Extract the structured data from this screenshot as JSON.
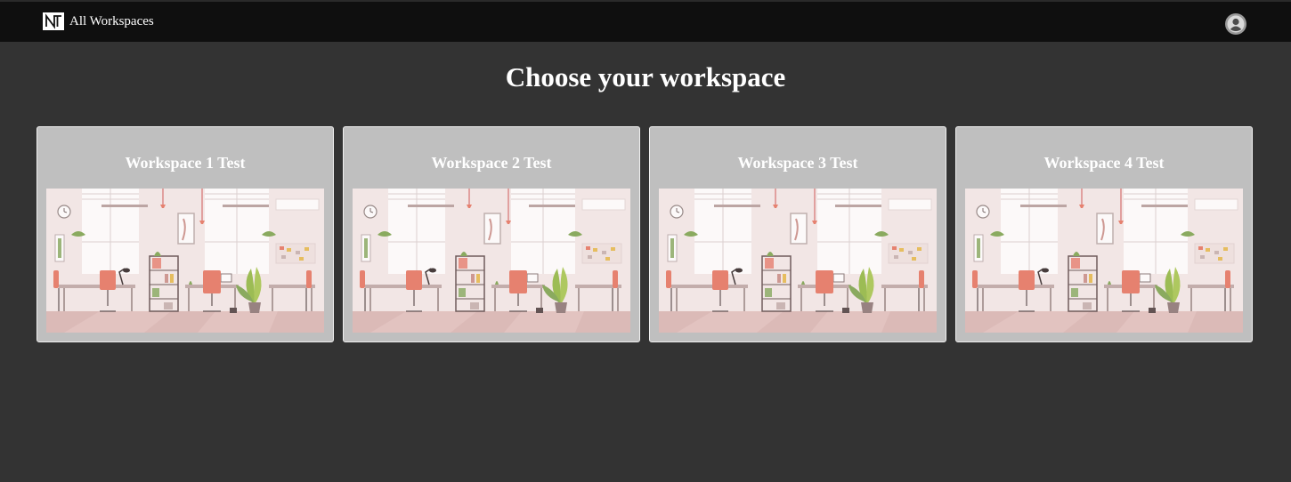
{
  "header": {
    "brand_label": "All Workspaces",
    "logo_icon": "nt-logo-icon",
    "account_icon": "account-circle-icon"
  },
  "main": {
    "title": "Choose your workspace"
  },
  "workspaces": [
    {
      "title": "Workspace 1 Test",
      "image": "office-illustration"
    },
    {
      "title": "Workspace 2 Test",
      "image": "office-illustration"
    },
    {
      "title": "Workspace 3 Test",
      "image": "office-illustration"
    },
    {
      "title": "Workspace 4 Test",
      "image": "office-illustration"
    }
  ],
  "colors": {
    "background": "#333333",
    "topbar": "#0f0f0f",
    "card": "#bfbfbf",
    "accent_chair": "#e5735d"
  }
}
